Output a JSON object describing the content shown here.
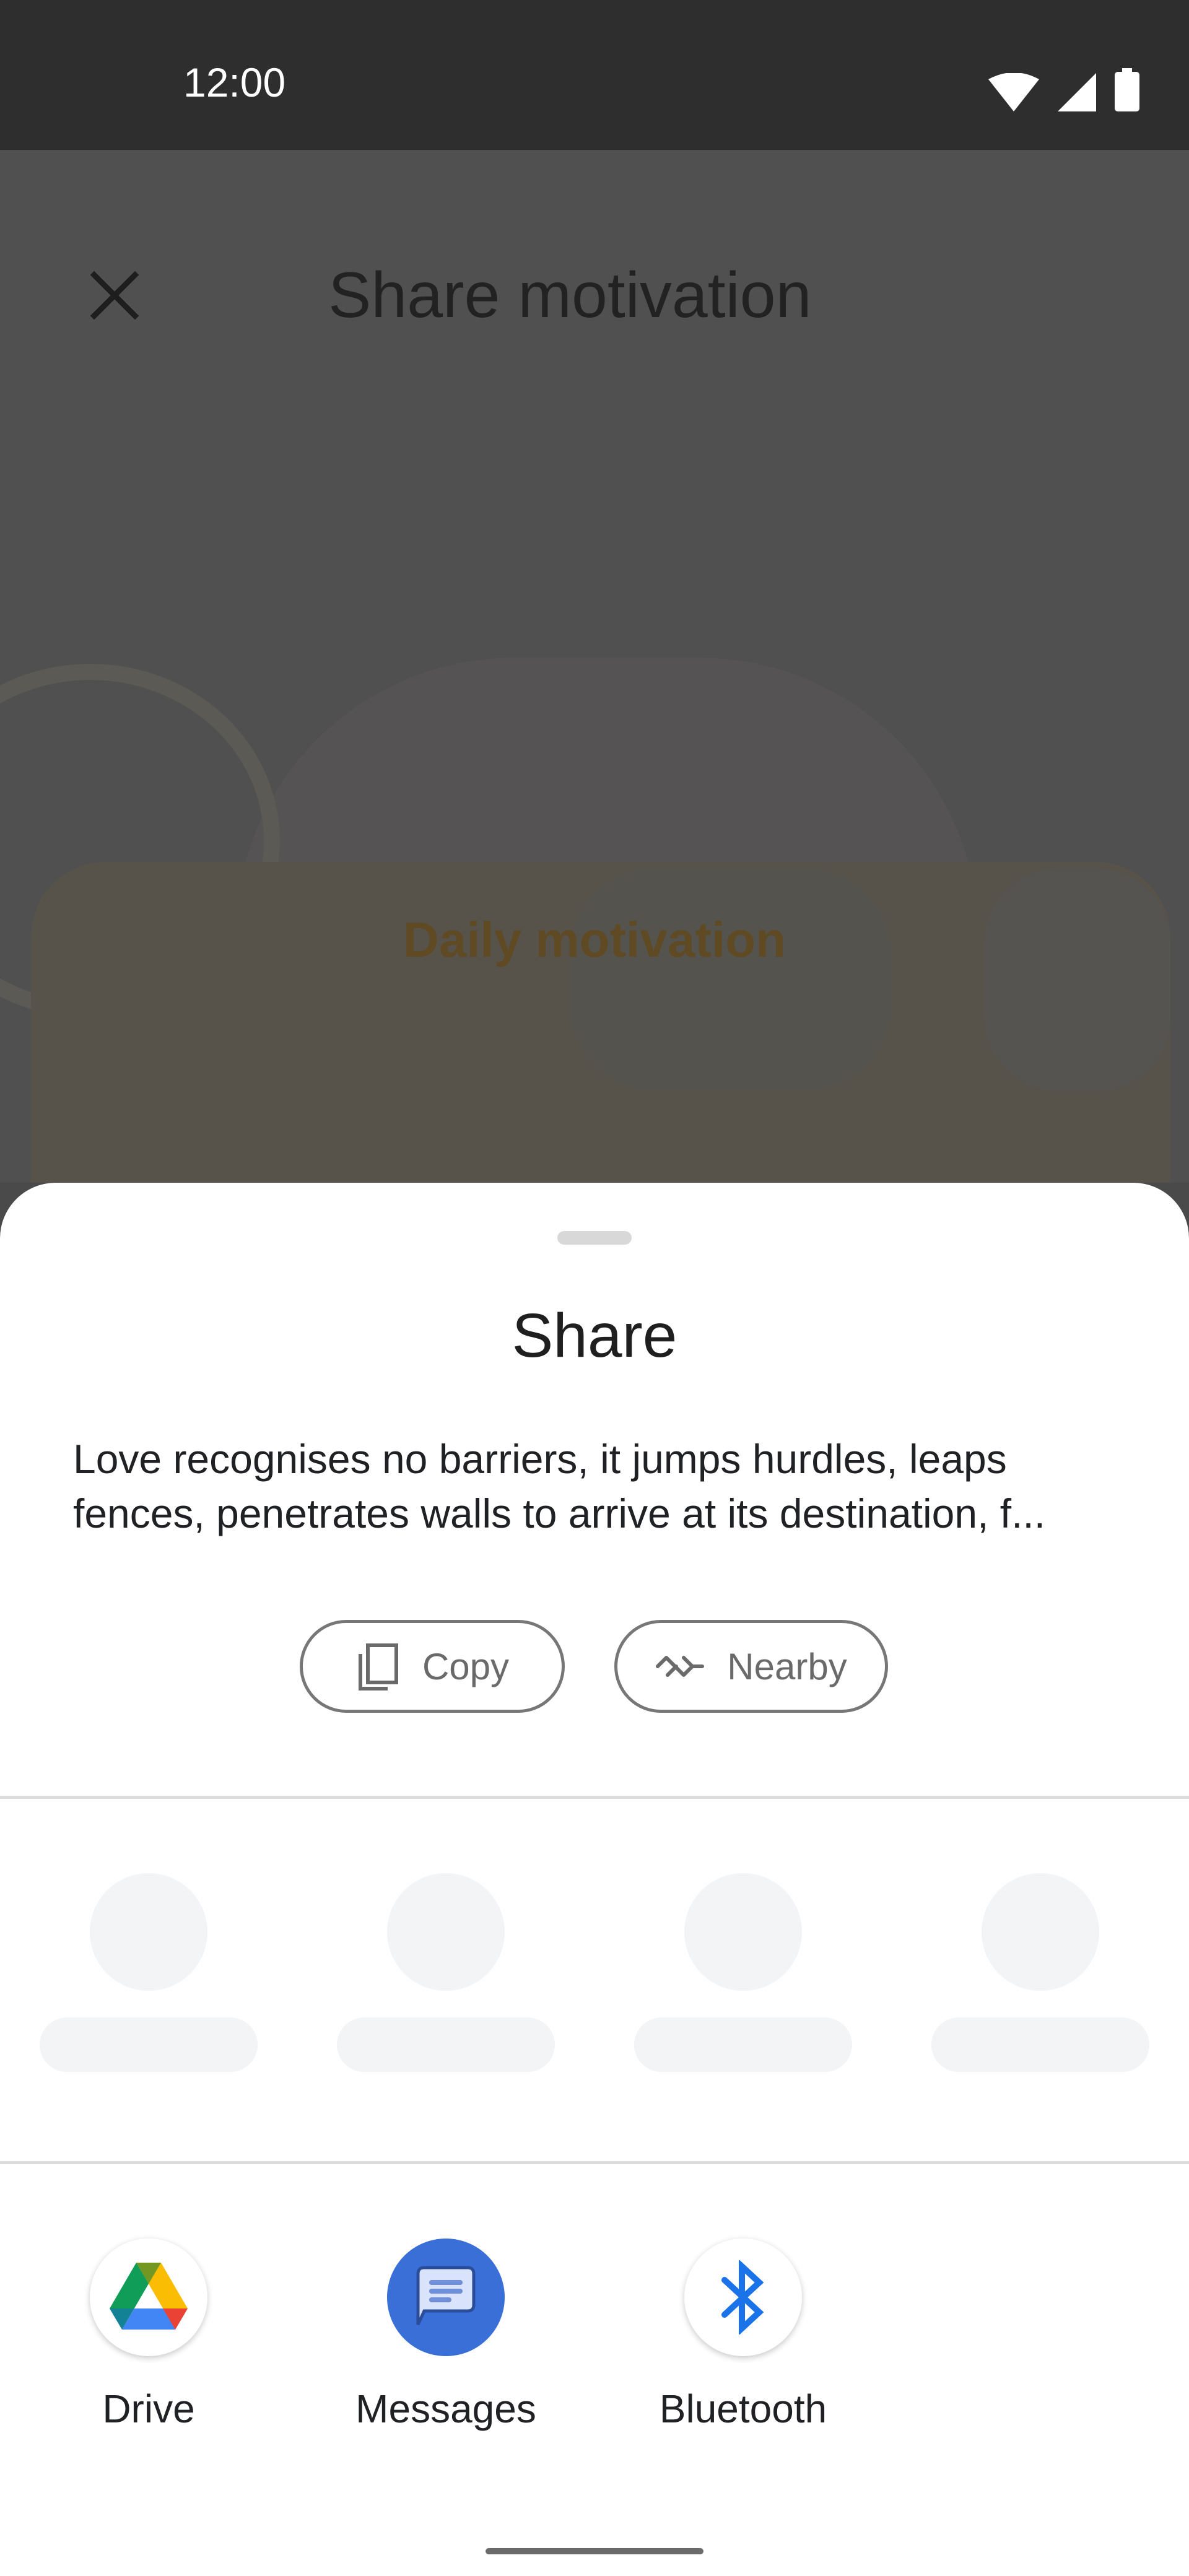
{
  "status_bar": {
    "time": "12:00",
    "icons": [
      "wifi-icon",
      "signal-icon",
      "battery-icon"
    ]
  },
  "background_app": {
    "title": "Share motivation",
    "card_title": "Daily motivation",
    "close_icon": "close-icon"
  },
  "share_sheet": {
    "title": "Share",
    "preview_text": "Love recognises no barriers, it jumps hurdles, leaps fences, penetrates walls to arrive at its destination, f...",
    "actions": [
      {
        "label": "Copy",
        "icon": "copy-icon"
      },
      {
        "label": "Nearby",
        "icon": "nearby-icon"
      }
    ],
    "apps": [
      {
        "label": "Drive",
        "icon": "drive-icon"
      },
      {
        "label": "Messages",
        "icon": "messages-icon"
      },
      {
        "label": "Bluetooth",
        "icon": "bluetooth-icon"
      }
    ]
  },
  "colors": {
    "accent": "#3a6fd8",
    "background_title": "#5f4a24"
  }
}
